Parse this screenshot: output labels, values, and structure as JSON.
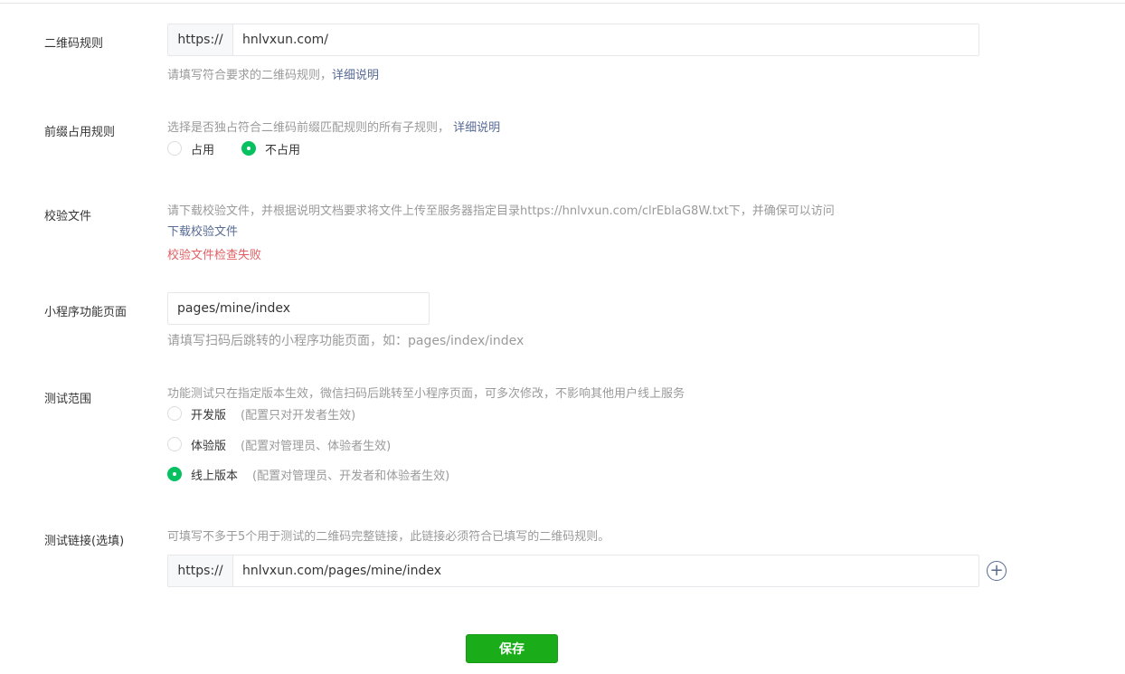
{
  "qr_rule": {
    "label": "二维码规则",
    "prefix": "https://",
    "value": "hnlvxun.com/",
    "hint": "请填写符合要求的二维码规则，",
    "hint_link": "详细说明"
  },
  "prefix_rule": {
    "label": "前缀占用规则",
    "hint": "选择是否独占符合二维码前缀匹配规则的所有子规则，",
    "hint_link": "详细说明",
    "options": [
      {
        "label": "占用",
        "checked": false
      },
      {
        "label": "不占用",
        "checked": true
      }
    ]
  },
  "verify_file": {
    "label": "校验文件",
    "hint": "请下载校验文件，并根据说明文档要求将文件上传至服务器指定目录https://hnlvxun.com/clrEblaG8W.txt下，并确保可以访问",
    "download_link": "下载校验文件",
    "error": "校验文件检查失败"
  },
  "mini_page": {
    "label": "小程序功能页面",
    "value": "pages/mine/index",
    "hint": "请填写扫码后跳转的小程序功能页面，如：pages/index/index"
  },
  "test_scope": {
    "label": "测试范围",
    "hint": "功能测试只在指定版本生效，微信扫码后跳转至小程序页面，可多次修改，不影响其他用户线上服务",
    "options": [
      {
        "label": "开发版",
        "note": "(配置只对开发者生效)",
        "checked": false
      },
      {
        "label": "体验版",
        "note": "(配置对管理员、体验者生效)",
        "checked": false
      },
      {
        "label": "线上版本",
        "note": "(配置对管理员、开发者和体验者生效)",
        "checked": true
      }
    ]
  },
  "test_link": {
    "label": "测试链接(选填)",
    "hint": "可填写不多于5个用于测试的二维码完整链接，此链接必须符合已填写的二维码规则。",
    "prefix": "https://",
    "value": "hnlvxun.com/pages/mine/index",
    "add_icon": "plus-circle-icon"
  },
  "save_label": "保存",
  "colors": {
    "accent_green": "#07c160",
    "button_green": "#1aad19",
    "link_blue": "#576b95",
    "error_red": "#e15f63"
  }
}
